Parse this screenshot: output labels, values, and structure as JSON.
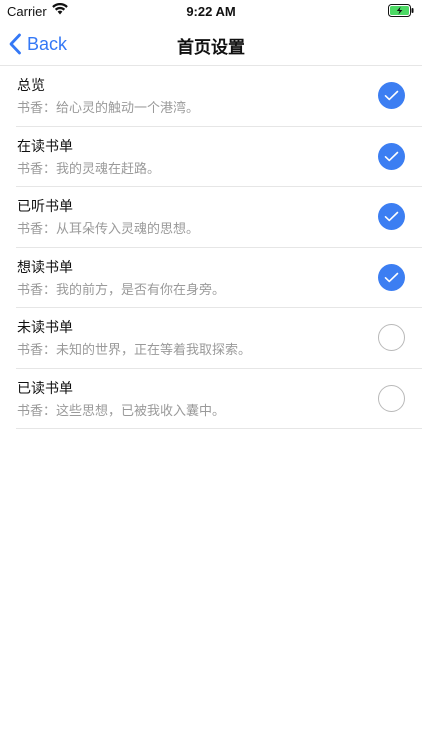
{
  "status_bar": {
    "carrier": "Carrier",
    "time": "9:22 AM"
  },
  "nav": {
    "back_label": "Back",
    "title": "首页设置"
  },
  "items": [
    {
      "title": "总览",
      "subtitle": "书香：给心灵的触动一个港湾。",
      "checked": true
    },
    {
      "title": "在读书单",
      "subtitle": "书香：我的灵魂在赶路。",
      "checked": true
    },
    {
      "title": "已听书单",
      "subtitle": "书香：从耳朵传入灵魂的思想。",
      "checked": true
    },
    {
      "title": "想读书单",
      "subtitle": "书香：我的前方，是否有你在身旁。",
      "checked": true
    },
    {
      "title": "未读书单",
      "subtitle": "书香：未知的世界，正在等着我取探索。",
      "checked": false
    },
    {
      "title": "已读书单",
      "subtitle": "书香：这些思想，已被我收入囊中。",
      "checked": false
    }
  ],
  "colors": {
    "accent": "#3478f6",
    "check_on": "#3c7ef2",
    "battery": "#4cd964"
  }
}
